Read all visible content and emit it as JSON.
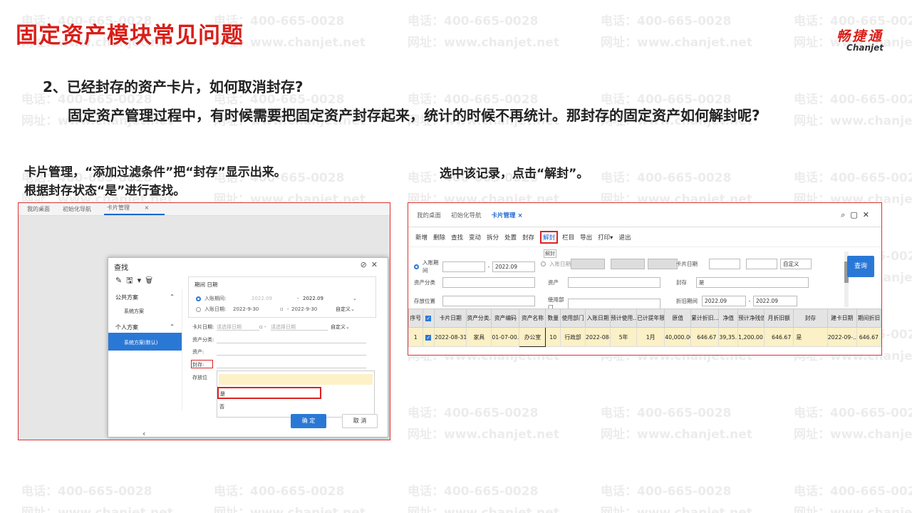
{
  "slide": {
    "title": "固定资产模块常见问题",
    "brand_cn": "畅捷通",
    "brand_en": "Chanjet",
    "question": "2、已经封存的资产卡片，如何取消封存?",
    "description": "固定资产管理过程中，有时候需要把固定资产封存起来，统计的时候不再统计。那封存的固定资产如何解封呢?",
    "step_left_1": "卡片管理，“添加过滤条件”把“封存”显示出来。",
    "step_left_2": "根据封存状态“是”进行查找。",
    "step_right": "选中该记录，点击“解封”。"
  },
  "watermark": {
    "phone": "电话：400-665-0028",
    "site": "网址：www.chanjet.net"
  },
  "left_shot": {
    "tabs": [
      "我的桌面",
      "初始化导航",
      "卡片管理"
    ],
    "tab_close": "×",
    "dialog": {
      "title": "查找",
      "head_icons": "⊘✕",
      "tool_icons": "✎🖫▾🗑",
      "public_group": "公共方案",
      "public_item": "系统方案",
      "personal_group": "个人方案",
      "personal_item": "系统方案(默认)",
      "back_icon": "‹",
      "period_title": "期间 日期",
      "period_label": "入账期间:",
      "period_from": "2022.09",
      "period_to": "2022.09",
      "date_label": "入账日期:",
      "date_from": "2022-9-30",
      "date_to": "2022-9-30",
      "custom": "自定义",
      "card_date_label": "卡片日期:",
      "card_date_ph": "请选择日期",
      "asset_class_label": "资产分类:",
      "asset_label": "资产:",
      "seal_label": "封存:",
      "store_label": "存放位",
      "opt_yes": "是",
      "opt_no": "否",
      "ok": "确 定",
      "cancel": "取 消"
    }
  },
  "right_shot": {
    "tabs": [
      "我的桌面",
      "初始化导航",
      "卡片管理 ×"
    ],
    "win_icons": "⌕▢✕",
    "toolbar": [
      "新增",
      "删除",
      "查找",
      "变动",
      "拆分",
      "处置",
      "封存",
      "解封",
      "栏目",
      "导出",
      "打印▾",
      "退出"
    ],
    "tooltip": "解封",
    "filters": {
      "period_label": "入账期间",
      "period_value": "2022.09",
      "date_label": "入账日期",
      "card_date_label": "卡片日期",
      "custom": "自定义",
      "asset_class_label": "资产分类",
      "asset_label": "资产",
      "seal_label": "封存",
      "seal_value": "是",
      "location_label": "存放位置",
      "dept_label": "使用部门",
      "dep_period_label": "折旧期间",
      "dep_from": "2022.09",
      "dep_to": "2022.09",
      "search_btn": "查询"
    },
    "columns": [
      "序号",
      "",
      "卡片日期",
      "资产分类...",
      "资产编码",
      "资产名称",
      "数量",
      "使用部门",
      "入账日期",
      "预计使用...",
      "已计提年限",
      "原值",
      "累计折旧...",
      "净值",
      "预计净残值",
      "月折旧额",
      "封存",
      "建卡日期",
      "期间折旧"
    ],
    "row": [
      "1",
      "",
      "2022-08-31",
      "家具",
      "01-07-00...",
      "办公室",
      "10",
      "行政部",
      "2022-08-...",
      "5年",
      "1月",
      "40,000.00",
      "646.67",
      "39,35...",
      "1,200.00",
      "646.67",
      "是",
      "2022-09-...",
      "646.67"
    ]
  }
}
